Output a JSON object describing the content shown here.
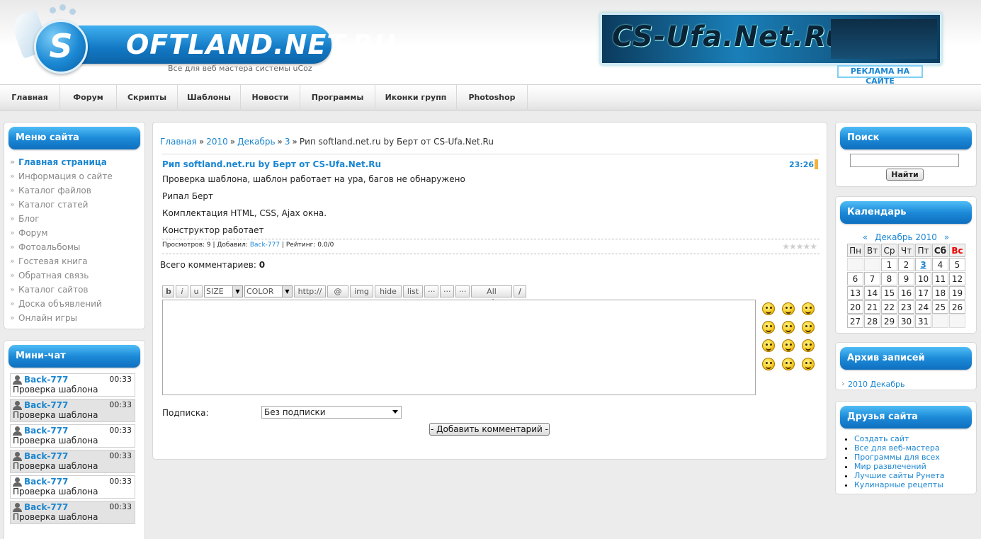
{
  "header": {
    "logo_letter": "S",
    "logo_text": "OFTLAND.NET.RU",
    "slogan": "Все для веб мастера системы uCoz",
    "banner_text": "CS-Ufa.Net.Ru",
    "ad_link": "РЕКЛАМА НА САЙТЕ"
  },
  "nav": [
    {
      "label": "Главная",
      "w": 85
    },
    {
      "label": "Форум",
      "w": 80
    },
    {
      "label": "Скрипты",
      "w": 86
    },
    {
      "label": "Шаблоны",
      "w": 89
    },
    {
      "label": "Новости",
      "w": 84
    },
    {
      "label": "Программы",
      "w": 106
    },
    {
      "label": "Иконки групп",
      "w": 115
    },
    {
      "label": "Photoshop",
      "w": 100
    }
  ],
  "site_menu": {
    "title": "Меню сайта",
    "items": [
      "Главная страница",
      "Информация о сайте",
      "Каталог файлов",
      "Каталог статей",
      "Блог",
      "Форум",
      "Фотоальбомы",
      "Гостевая книга",
      "Обратная связь",
      "Каталог сайтов",
      "Доска объявлений",
      "Онлайн игры"
    ]
  },
  "minichat": {
    "title": "Мини-чат",
    "messages": [
      {
        "user": "Back-777",
        "time": "00:33",
        "text": "Проверка шаблона"
      },
      {
        "user": "Back-777",
        "time": "00:33",
        "text": "Проверка шаблона"
      },
      {
        "user": "Back-777",
        "time": "00:33",
        "text": "Проверка шаблона"
      },
      {
        "user": "Back-777",
        "time": "00:33",
        "text": "Проверка шаблона"
      },
      {
        "user": "Back-777",
        "time": "00:33",
        "text": "Проверка шаблона"
      },
      {
        "user": "Back-777",
        "time": "00:33",
        "text": "Проверка шаблона"
      }
    ]
  },
  "breadcrumb": {
    "home": "Главная",
    "year": "2010",
    "month": "Декабрь",
    "day": "3",
    "current": "Рип softland.net.ru by Берт от CS-Ufa.Net.Ru"
  },
  "entry": {
    "title": "Рип softland.net.ru by Берт от CS-Ufa.Net.Ru",
    "time": "23:26",
    "paragraphs": [
      "Проверка шаблона, шаблон работает на ура, багов не обнаружено",
      "Рипал Берт",
      "Комплектация HTML, CSS, Ajax окна.",
      "Конструктор работает"
    ],
    "views_label": "Просмотров: 9",
    "added_label": "Добавил:",
    "author": "Back-777",
    "rating_label": "Рейтинг: 0.0/0",
    "stars": "★★★★★"
  },
  "comments": {
    "total_label": "Всего комментариев:",
    "total": "0",
    "bb_buttons": [
      "b",
      "i",
      "u"
    ],
    "size_select": "SIZE",
    "color_select": "COLOR",
    "bb_more": [
      "http://",
      "@",
      "img",
      "hide",
      "list",
      "···",
      "···",
      "···",
      "All codes",
      "/"
    ],
    "smiles": [
      "angry-smile-icon",
      "grin-smile-icon",
      "cool-smile-icon",
      "shock-smile-icon",
      "happy-smile-icon",
      "wink-smile-icon",
      "sad-smile-icon",
      "smile-icon",
      "surprised-smile-icon",
      "tongue-smile-icon",
      "confused-smile-icon",
      "sly-smile-icon"
    ],
    "subscribe_label": "Подписка:",
    "subscribe_value": "Без подписки",
    "submit": "- Добавить комментарий -"
  },
  "search": {
    "title": "Поиск",
    "button": "Найти"
  },
  "calendar": {
    "title": "Календарь",
    "prev": "«",
    "month": "Декабрь 2010",
    "next": "»",
    "weekdays": [
      "Пн",
      "Вт",
      "Ср",
      "Чт",
      "Пт",
      "Сб",
      "Вс"
    ],
    "weeks": [
      [
        "",
        "",
        "1",
        "2",
        "3",
        "4",
        "5"
      ],
      [
        "6",
        "7",
        "8",
        "9",
        "10",
        "11",
        "12"
      ],
      [
        "13",
        "14",
        "15",
        "16",
        "17",
        "18",
        "19"
      ],
      [
        "20",
        "21",
        "22",
        "23",
        "24",
        "25",
        "26"
      ],
      [
        "27",
        "28",
        "29",
        "30",
        "31",
        "",
        ""
      ]
    ],
    "linked_day": "3"
  },
  "archive": {
    "title": "Архив записей",
    "items": [
      "2010 Декабрь"
    ]
  },
  "friends": {
    "title": "Друзья сайта",
    "items": [
      "Создать сайт",
      "Все для веб-мастера",
      "Программы для всех",
      "Мир развлечений",
      "Лучшие сайты Рунета",
      "Кулинарные рецепты"
    ]
  },
  "colors": {
    "accent": "#1b86d1",
    "panel_header": "#1c8ad8",
    "sunday": "#e00000"
  }
}
